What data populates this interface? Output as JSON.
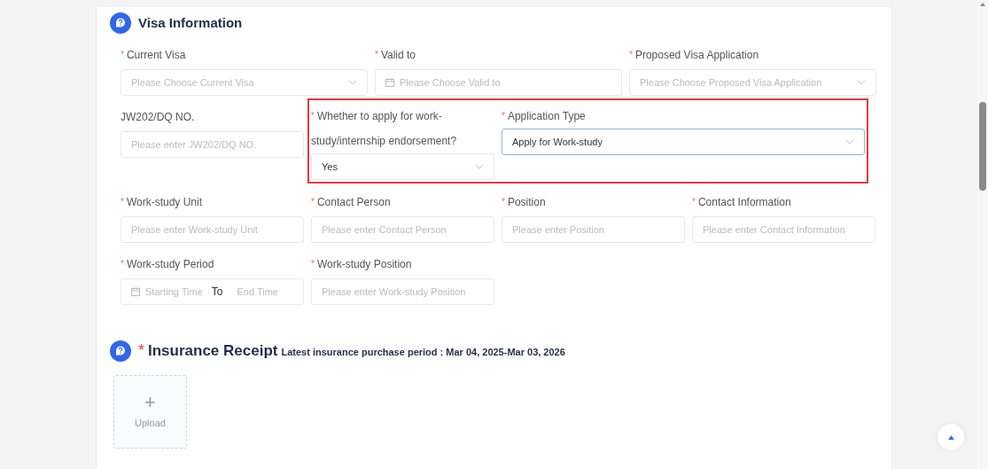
{
  "visa_section": {
    "title": "Visa Information",
    "rows": [
      {
        "fields": [
          {
            "kind": "select",
            "marker": "*",
            "label": "Current Visa",
            "placeholder": "Please Choose Current Visa"
          },
          {
            "kind": "date",
            "marker": "*",
            "label": "Valid to",
            "placeholder": "Please Choose Valid to"
          },
          {
            "kind": "select",
            "marker": "*",
            "label": "Proposed Visa Application",
            "placeholder": "Please Choose Proposed Visa Application"
          }
        ]
      },
      {
        "fields": [
          {
            "kind": "input",
            "label": "JW202/DQ NO.",
            "placeholder": "Please enter JW202/DQ NO."
          }
        ],
        "highlighted": {
          "fields": [
            {
              "kind": "select",
              "marker": "*",
              "label": "Whether to apply for work-study/internship endorsement?",
              "value": "Yes",
              "focused": false
            },
            {
              "kind": "select",
              "marker": "*",
              "label": "Application Type",
              "value": "Apply for Work-study",
              "focused": true
            }
          ]
        }
      },
      {
        "fields": [
          {
            "kind": "input",
            "marker": "*",
            "label": "Work-study Unit",
            "placeholder": "Please enter Work-study Unit"
          },
          {
            "kind": "input",
            "marker": "*",
            "label": "Contact Person",
            "placeholder": "Please enter Contact Person"
          },
          {
            "kind": "input",
            "marker": "*",
            "label": "Position",
            "placeholder": "Please enter Position"
          },
          {
            "kind": "input",
            "marker": "*",
            "label": "Contact Information",
            "placeholder": "Please enter Contact Information"
          }
        ]
      },
      {
        "fields": [
          {
            "kind": "daterange",
            "marker": "*",
            "label": "Work-study Period",
            "start_placeholder": "Starting Time",
            "separator": "To",
            "end_placeholder": "End Time"
          },
          {
            "kind": "input",
            "marker": "*",
            "label": "Work-study Position",
            "placeholder": "Please enter Work-study Position"
          }
        ]
      }
    ]
  },
  "insurance_section": {
    "marker": "*",
    "title": "Insurance Receipt",
    "note": "Latest insurance purchase period : Mar 04, 2025-Mar 03, 2026",
    "upload": {
      "symbol": "+",
      "label": "Upload"
    }
  }
}
